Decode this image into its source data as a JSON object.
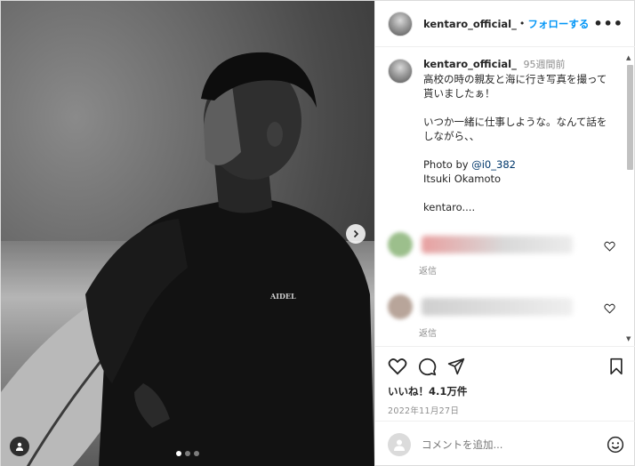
{
  "post": {
    "username": "kentaro_official_",
    "separator": "•",
    "follow_label": "フォローする",
    "more_label": "•••",
    "caption": {
      "username": "kentaro_official_",
      "time_ago": "95週間前",
      "line1": "高校の時の親友と海に行き写真を撮って貰いましたぁ！",
      "line2": "いつか一緒に仕事しような。なんて話をしながら、、",
      "photo_by": "Photo by ",
      "photo_by_handle": "@i0_382",
      "photographer": "Itsuki Okamoto",
      "truncated": "kentaro...."
    },
    "comments": [
      {
        "reply_label": "返信",
        "avatar_color": "#9cbf8c",
        "text_color": "#e8a0a0"
      },
      {
        "reply_label": "返信",
        "avatar_color": "#b8a59a",
        "text_color": "#cfcfcf"
      }
    ],
    "likes": "いいね！4.1万件",
    "date": "2022年11月27日",
    "comment_placeholder": "コメントを追加...",
    "photo": {
      "wetsuit_text": "AIDEL",
      "carousel_count": 3,
      "active_index": 0
    }
  },
  "colors": {
    "accent": "#0095f6",
    "link": "#00376b",
    "muted": "#8e8e8e"
  }
}
